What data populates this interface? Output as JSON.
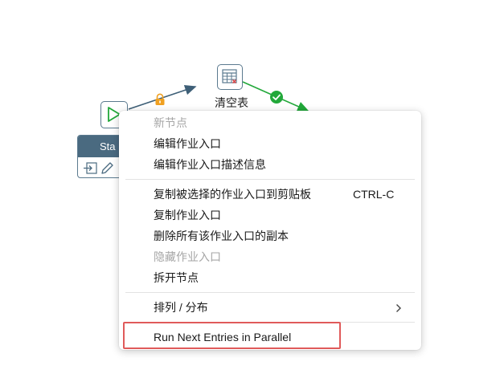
{
  "canvas": {
    "table_node_label": "清空表",
    "start_node_label": "Sta"
  },
  "context_menu": {
    "items": [
      {
        "label": "新节点",
        "disabled": true
      },
      {
        "label": "编辑作业入口",
        "disabled": false
      },
      {
        "label": "编辑作业入口描述信息",
        "disabled": false
      },
      {
        "label": "复制被选择的作业入口到剪贴板",
        "disabled": false,
        "shortcut": "CTRL-C"
      },
      {
        "label": "复制作业入口",
        "disabled": false
      },
      {
        "label": "删除所有该作业入口的副本",
        "disabled": false
      },
      {
        "label": "隐藏作业入口",
        "disabled": true
      },
      {
        "label": "拆开节点",
        "disabled": false
      },
      {
        "label": "排列 / 分布",
        "disabled": false,
        "submenu": true
      },
      {
        "label": "Run Next Entries in Parallel",
        "disabled": false,
        "highlighted": true
      }
    ]
  },
  "colors": {
    "highlight_border": "#e05a5a",
    "success_green": "#22a83a",
    "hop_blue": "#3e5f77",
    "lock_orange": "#f0a020"
  }
}
